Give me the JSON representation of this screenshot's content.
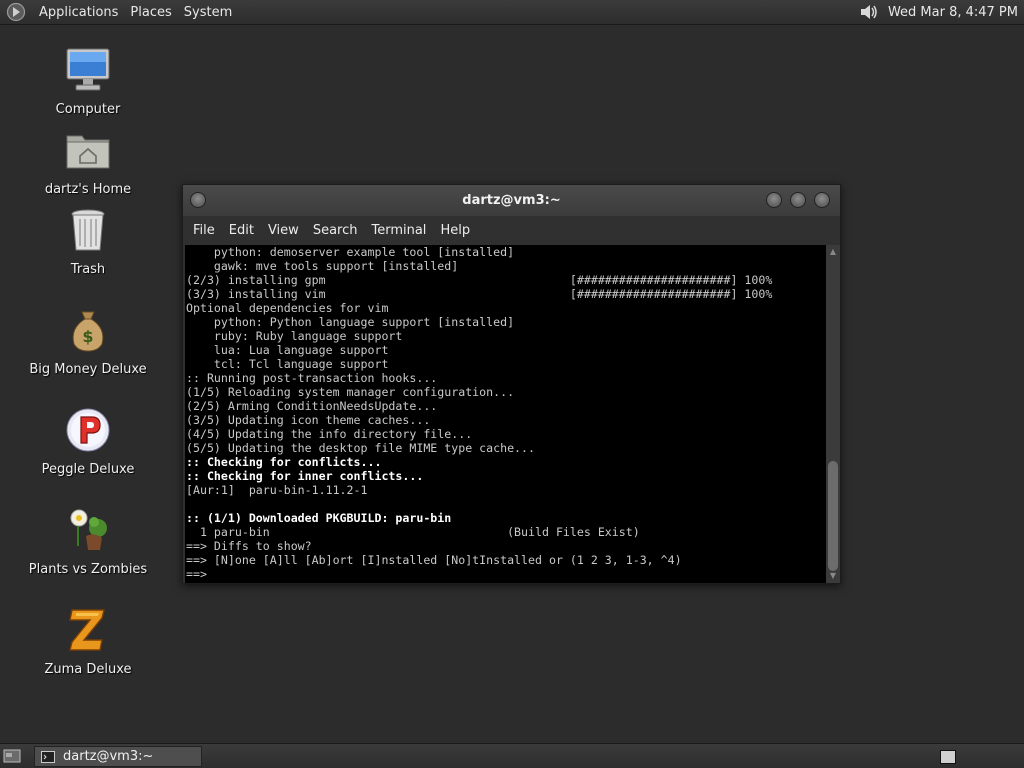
{
  "top_panel": {
    "menus": [
      "Applications",
      "Places",
      "System"
    ],
    "clock": "Wed Mar  8,  4:47 PM"
  },
  "desktop": {
    "icons": [
      {
        "label": "Computer",
        "icon": "computer-icon"
      },
      {
        "label": "dartz's Home",
        "icon": "home-folder-icon"
      },
      {
        "label": "Trash",
        "icon": "trash-icon"
      },
      {
        "label": "Big Money Deluxe",
        "icon": "money-bag-icon"
      },
      {
        "label": "Peggle Deluxe",
        "icon": "peggle-icon"
      },
      {
        "label": "Plants vs Zombies",
        "icon": "plants-vs-zombies-icon"
      },
      {
        "label": "Zuma Deluxe",
        "icon": "zuma-icon"
      }
    ]
  },
  "terminal": {
    "title": "dartz@vm3:~",
    "menu": [
      "File",
      "Edit",
      "View",
      "Search",
      "Terminal",
      "Help"
    ],
    "lines": [
      {
        "text": "    python: demoserver example tool [installed]",
        "bold": false
      },
      {
        "text": "    gawk: mve tools support [installed]",
        "bold": false
      },
      {
        "text": "(2/3) installing gpm                                   [######################] 100%",
        "bold": false
      },
      {
        "text": "(3/3) installing vim                                   [######################] 100%",
        "bold": false
      },
      {
        "text": "Optional dependencies for vim",
        "bold": false
      },
      {
        "text": "    python: Python language support [installed]",
        "bold": false
      },
      {
        "text": "    ruby: Ruby language support",
        "bold": false
      },
      {
        "text": "    lua: Lua language support",
        "bold": false
      },
      {
        "text": "    tcl: Tcl language support",
        "bold": false
      },
      {
        "text": ":: Running post-transaction hooks...",
        "bold": false
      },
      {
        "text": "(1/5) Reloading system manager configuration...",
        "bold": false
      },
      {
        "text": "(2/5) Arming ConditionNeedsUpdate...",
        "bold": false
      },
      {
        "text": "(3/5) Updating icon theme caches...",
        "bold": false
      },
      {
        "text": "(4/5) Updating the info directory file...",
        "bold": false
      },
      {
        "text": "(5/5) Updating the desktop file MIME type cache...",
        "bold": false
      },
      {
        "text": ":: Checking for conflicts...",
        "bold": true
      },
      {
        "text": ":: Checking for inner conflicts...",
        "bold": true
      },
      {
        "text": "[Aur:1]  paru-bin-1.11.2-1",
        "bold": false
      },
      {
        "text": "",
        "bold": false
      },
      {
        "text": ":: (1/1) Downloaded PKGBUILD: paru-bin",
        "bold": true
      },
      {
        "text": "  1 paru-bin                                  (Build Files Exist)",
        "bold": false
      },
      {
        "text": "==> Diffs to show?",
        "bold": false
      },
      {
        "text": "==> [N]one [A]ll [Ab]ort [I]nstalled [No]tInstalled or (1 2 3, 1-3, ^4)",
        "bold": false
      },
      {
        "text": "==>",
        "bold": false
      }
    ]
  },
  "taskbar": {
    "task_label": "dartz@vm3:~"
  },
  "colors": {
    "desktop_bg": "#2b2c2b",
    "terminal_bg": "#000000",
    "terminal_fg": "#c9c9c9"
  }
}
